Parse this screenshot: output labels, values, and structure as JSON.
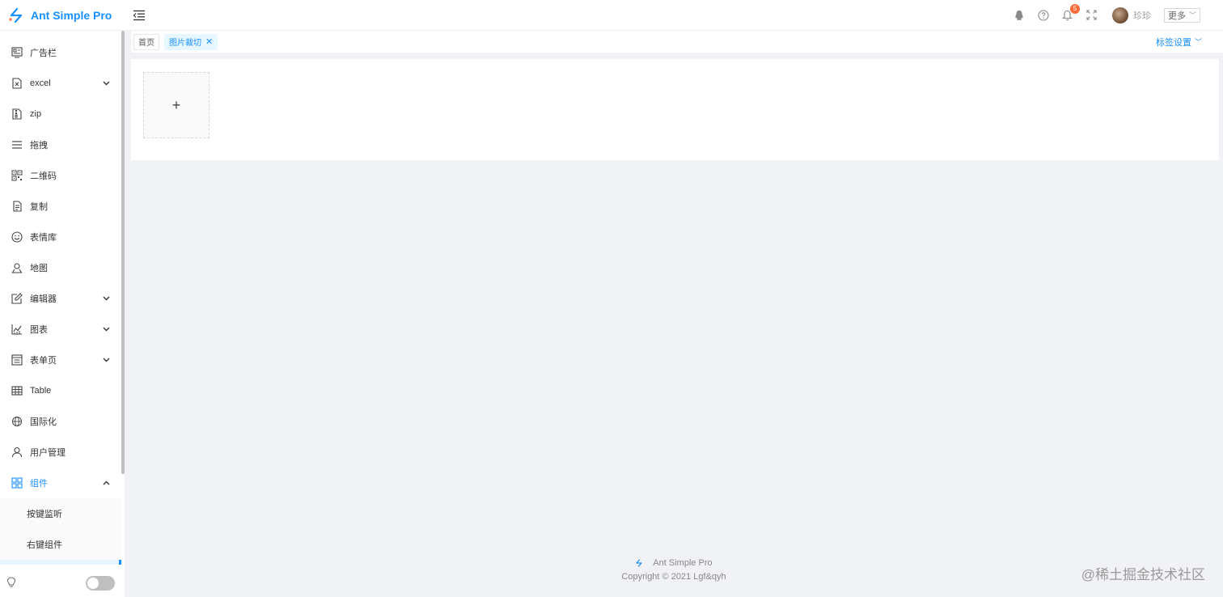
{
  "app": {
    "title": "Ant Simple Pro",
    "brand_color": "#1890ff"
  },
  "header": {
    "notification_count": "5",
    "user_name": "珍珍",
    "more_label": "更多"
  },
  "sidebar": {
    "items": [
      {
        "label": "广告栏",
        "icon": "ad-icon",
        "has_submenu": false
      },
      {
        "label": "excel",
        "icon": "excel-icon",
        "has_submenu": true
      },
      {
        "label": "zip",
        "icon": "zip-icon",
        "has_submenu": false
      },
      {
        "label": "拖拽",
        "icon": "list-icon",
        "has_submenu": false
      },
      {
        "label": "二维码",
        "icon": "qrcode-icon",
        "has_submenu": false
      },
      {
        "label": "复制",
        "icon": "copy-icon",
        "has_submenu": false
      },
      {
        "label": "表情库",
        "icon": "smile-icon",
        "has_submenu": false
      },
      {
        "label": "地图",
        "icon": "map-icon",
        "has_submenu": false
      },
      {
        "label": "编辑器",
        "icon": "edit-icon",
        "has_submenu": true
      },
      {
        "label": "图表",
        "icon": "chart-icon",
        "has_submenu": true
      },
      {
        "label": "表单页",
        "icon": "form-icon",
        "has_submenu": true
      },
      {
        "label": "Table",
        "icon": "table-icon",
        "has_submenu": false
      },
      {
        "label": "国际化",
        "icon": "globe-icon",
        "has_submenu": false
      },
      {
        "label": "用户管理",
        "icon": "user-icon",
        "has_submenu": false
      },
      {
        "label": "组件",
        "icon": "appstore-icon",
        "has_submenu": true,
        "expanded": true,
        "active": true
      }
    ],
    "subitems": [
      {
        "label": "按键监听"
      },
      {
        "label": "右键组件"
      }
    ]
  },
  "tabs": {
    "items": [
      {
        "label": "首页",
        "active": false
      },
      {
        "label": "图片裁切",
        "active": true
      }
    ],
    "settings_label": "标签设置"
  },
  "footer": {
    "brand": "Ant Simple Pro",
    "copyright": "Copyright © 2021 Lgf&qyh"
  },
  "watermark": "@稀土掘金技术社区"
}
